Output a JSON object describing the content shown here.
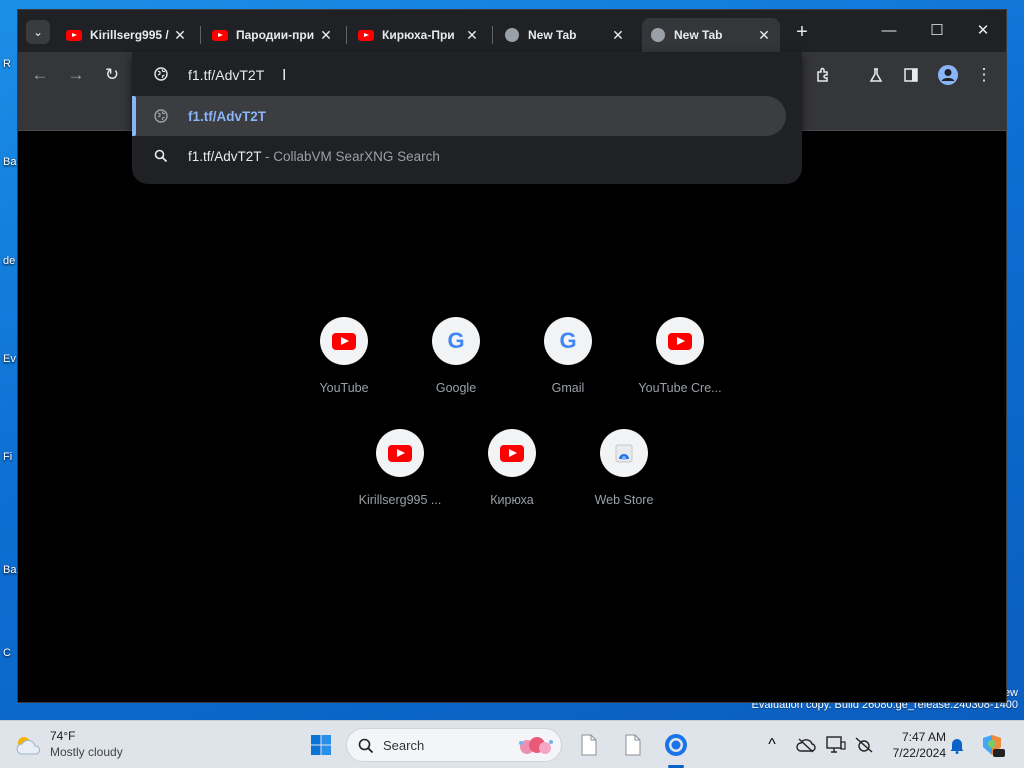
{
  "desktop": {
    "icon_labels": [
      "R",
      "Ba",
      "de",
      "Ev",
      "Fi",
      "Ba",
      "C"
    ],
    "watermark_lines": [
      "ew",
      "Evaluation copy. Build 26080.ge_release.240308-1400"
    ]
  },
  "browser": {
    "tabs": [
      {
        "title": "Kirillserg995 /",
        "favicon": "youtube-icon",
        "active": false
      },
      {
        "title": "Пародии-при",
        "favicon": "youtube-icon",
        "active": false
      },
      {
        "title": "Кирюха-При",
        "favicon": "youtube-icon",
        "active": false
      },
      {
        "title": "New Tab",
        "favicon": "globe-icon",
        "active": false
      },
      {
        "title": "New Tab",
        "favicon": "globe-icon",
        "active": true
      }
    ],
    "tab_close_glyph": "✕",
    "new_tab_glyph": "+",
    "window_controls": [
      "—",
      "☐",
      "✕"
    ],
    "toolbar_glyphs": {
      "back": "←",
      "forward": "→",
      "reload": "↻",
      "menu": "⋮"
    },
    "omnibox": {
      "value": "f1.tf/AdvT2T",
      "suggestions": [
        {
          "text": "f1.tf/AdvT2T",
          "description": "",
          "icon": "globe-icon",
          "selected": true
        },
        {
          "text": "f1.tf/AdvT2T",
          "description": " - CollabVM SearXNG Search",
          "icon": "search-icon",
          "selected": false
        }
      ]
    },
    "shortcuts": [
      {
        "label": "YouTube",
        "icon": "youtube-icon"
      },
      {
        "label": "Google",
        "icon": "google-icon"
      },
      {
        "label": "Gmail",
        "icon": "google-icon"
      },
      {
        "label": "YouTube Cre...",
        "icon": "youtube-icon"
      },
      {
        "label": "Kirillserg995 ...",
        "icon": "youtube-icon"
      },
      {
        "label": "Кирюха",
        "icon": "youtube-icon"
      },
      {
        "label": "Web Store",
        "icon": "web-store-icon"
      }
    ],
    "google_letter": "G"
  },
  "taskbar": {
    "weather_temp": "74°F",
    "weather_condition": "Mostly cloudy",
    "search_label": "Search",
    "time": "7:47 AM",
    "date": "7/22/2024",
    "tray_glyph": "^"
  },
  "colors": {
    "accent_blue": "#8ab4f8",
    "youtube_red": "#ff0000",
    "tab_active": "#35363a",
    "tabstrip": "#202124"
  }
}
